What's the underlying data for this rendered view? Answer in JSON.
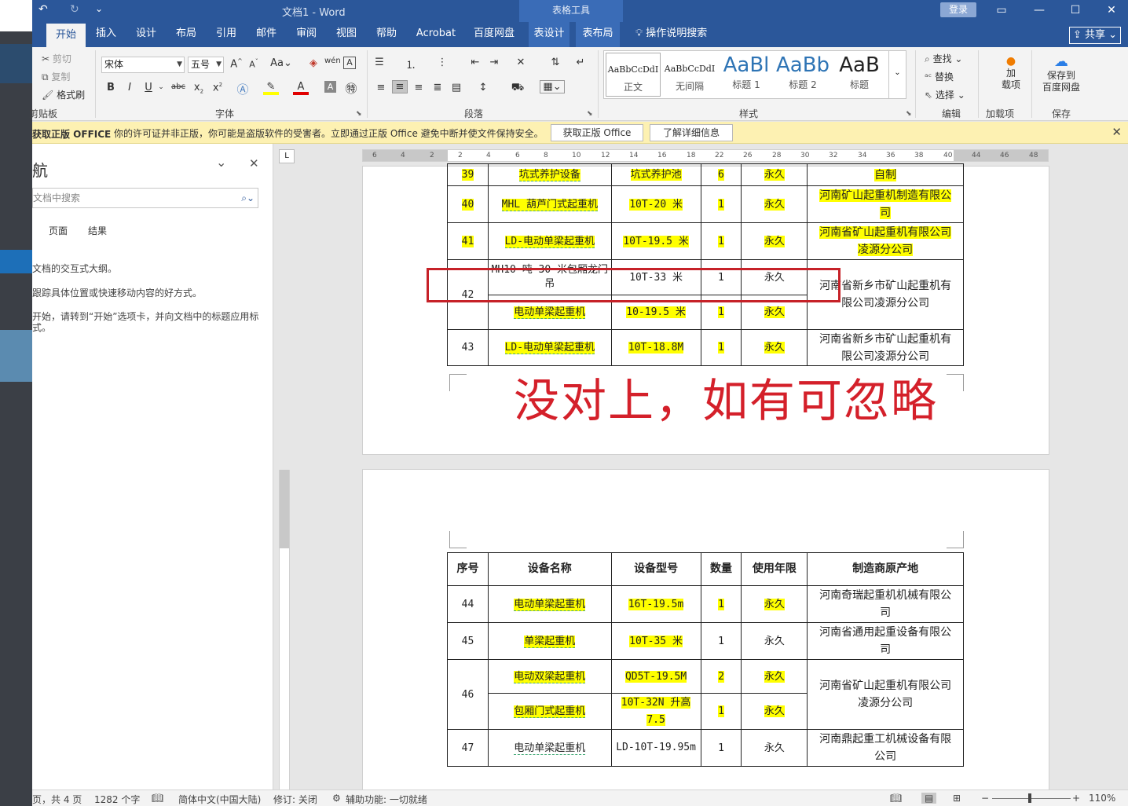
{
  "titlebar": {
    "undo": "↶",
    "redo": "↻",
    "customize": "⌄",
    "doc_title": "文档1 - Word",
    "table_tools": "表格工具",
    "login": "登录",
    "restore": "▭",
    "minimize": "—",
    "maximize": "☐",
    "close": "✕"
  },
  "tabs": [
    {
      "label": "开始"
    },
    {
      "label": "插入"
    },
    {
      "label": "设计"
    },
    {
      "label": "布局"
    },
    {
      "label": "引用"
    },
    {
      "label": "邮件"
    },
    {
      "label": "审阅"
    },
    {
      "label": "视图"
    },
    {
      "label": "帮助"
    },
    {
      "label": "Acrobat"
    },
    {
      "label": "百度网盘"
    },
    {
      "label": "表设计"
    },
    {
      "label": "表布局"
    }
  ],
  "tell_me": "操作说明搜索",
  "share": "共享",
  "ribbon": {
    "clipboard": {
      "cut": "剪切",
      "copy": "复制",
      "format_painter": "格式刷",
      "label": "剪贴板"
    },
    "font": {
      "name": "宋体",
      "size": "五号",
      "label": "字体"
    },
    "paragraph": {
      "label": "段落"
    },
    "styles": {
      "label": "样式",
      "items": [
        {
          "preview": "AaBbCcDdI",
          "name": "正文"
        },
        {
          "preview": "AaBbCcDdI",
          "name": "无间隔"
        },
        {
          "preview": "AaBl",
          "name": "标题 1"
        },
        {
          "preview": "AaBb",
          "name": "标题 2"
        },
        {
          "preview": "AaB",
          "name": "标题"
        }
      ]
    },
    "editing": {
      "find": "查找",
      "replace": "替换",
      "select": "选择",
      "label": "编辑"
    },
    "addins": {
      "load": "加\n载项",
      "label": "加载项"
    },
    "save": {
      "btn": "保存到\n百度网盘",
      "label": "保存"
    }
  },
  "warning": {
    "title": "获取正版 OFFICE",
    "message": "你的许可证并非正版，你可能是盗版软件的受害者。立即通过正版 Office 避免中断并使文件保持安全。",
    "btn_get": "获取正版 Office",
    "btn_more": "了解详细信息",
    "close": "✕"
  },
  "nav": {
    "title": "航",
    "search_placeholder": "文档中搜索",
    "tabs": [
      "页面",
      "结果"
    ],
    "text1": "文档的交互式大纲。",
    "text2": "跟踪具体位置或快速移动内容的好方式。",
    "text3": "开始，请转到“开始”选项卡，并向文档中的标题应用标式。"
  },
  "ruler": {
    "h": [
      "6",
      "4",
      "2",
      "2",
      "4",
      "6",
      "8",
      "10",
      "12",
      "14",
      "16",
      "18",
      "22",
      "26",
      "28",
      "30",
      "32",
      "34",
      "36",
      "38",
      "40",
      "44",
      "46",
      "48"
    ],
    "corner": "L"
  },
  "page1": {
    "rows": [
      {
        "no": "39",
        "name": "坑式养护设备",
        "model": "坑式养护池",
        "qty": "6",
        "life": "永久",
        "mfr": "自制"
      },
      {
        "no": "40",
        "name": "MHL 葫芦门式起重机",
        "model": "10T-20 米",
        "qty": "1",
        "life": "永久",
        "mfr": "河南矿山起重机制造有限公司"
      },
      {
        "no": "41",
        "name": "LD-电动单梁起重机",
        "model": "10T-19.5 米",
        "qty": "1",
        "life": "永久",
        "mfr": "河南省矿山起重机有限公司凌源分公司"
      },
      {
        "no": "42",
        "name": "MH10 吨-30 米包厢龙门吊",
        "model": "10T-33 米",
        "qty": "1",
        "life": "永久",
        "mfr": "河南省新乡市矿山起重机有限公司凌源分公司"
      },
      {
        "no": "",
        "name": "电动单梁起重机",
        "model": "10-19.5 米",
        "qty": "1",
        "life": "永久",
        "mfr": ""
      },
      {
        "no": "43",
        "name": "LD-电动单梁起重机",
        "model": "10T-18.8M",
        "qty": "1",
        "life": "永久",
        "mfr": "河南省新乡市矿山起重机有限公司凌源分公司"
      }
    ],
    "annotation": "没对上，如有可忽略"
  },
  "page2": {
    "header": {
      "no": "序号",
      "name": "设备名称",
      "model": "设备型号",
      "qty": "数量",
      "life": "使用年限",
      "mfr": "制造商原产地"
    },
    "rows": [
      {
        "no": "44",
        "name": "电动单梁起重机",
        "model": "16T-19.5m",
        "qty": "1",
        "life": "永久",
        "mfr": "河南奇瑞起重机机械有限公司"
      },
      {
        "no": "45",
        "name": "单梁起重机",
        "model": "10T-35 米",
        "qty": "1",
        "life": "永久",
        "mfr": "河南省通用起重设备有限公司"
      },
      {
        "no": "46",
        "name": "电动双梁起重机",
        "model": "QD5T-19.5M",
        "qty": "2",
        "life": "永久",
        "mfr": "河南省矿山起重机有限公司凌源分公司"
      },
      {
        "no": "",
        "name": "包厢门式起重机",
        "model": "10T-32N 升高 7.5",
        "qty": "1",
        "life": "永久",
        "mfr": ""
      },
      {
        "no": "47",
        "name": "电动单梁起重机",
        "model": "LD-10T-19.95m",
        "qty": "1",
        "life": "永久",
        "mfr": "河南鼎起重工机械设备有限公司"
      }
    ]
  },
  "status": {
    "pages": "页，共 4 页",
    "words": "1282 个字",
    "lang": "简体中文(中国大陆)",
    "track": "修订: 关闭",
    "access": "辅助功能: 一切就绪",
    "zoom": "110%"
  },
  "colors": {
    "word_blue": "#2b579a",
    "highlight": "#ffff00",
    "annotation_red": "#d4202a"
  }
}
